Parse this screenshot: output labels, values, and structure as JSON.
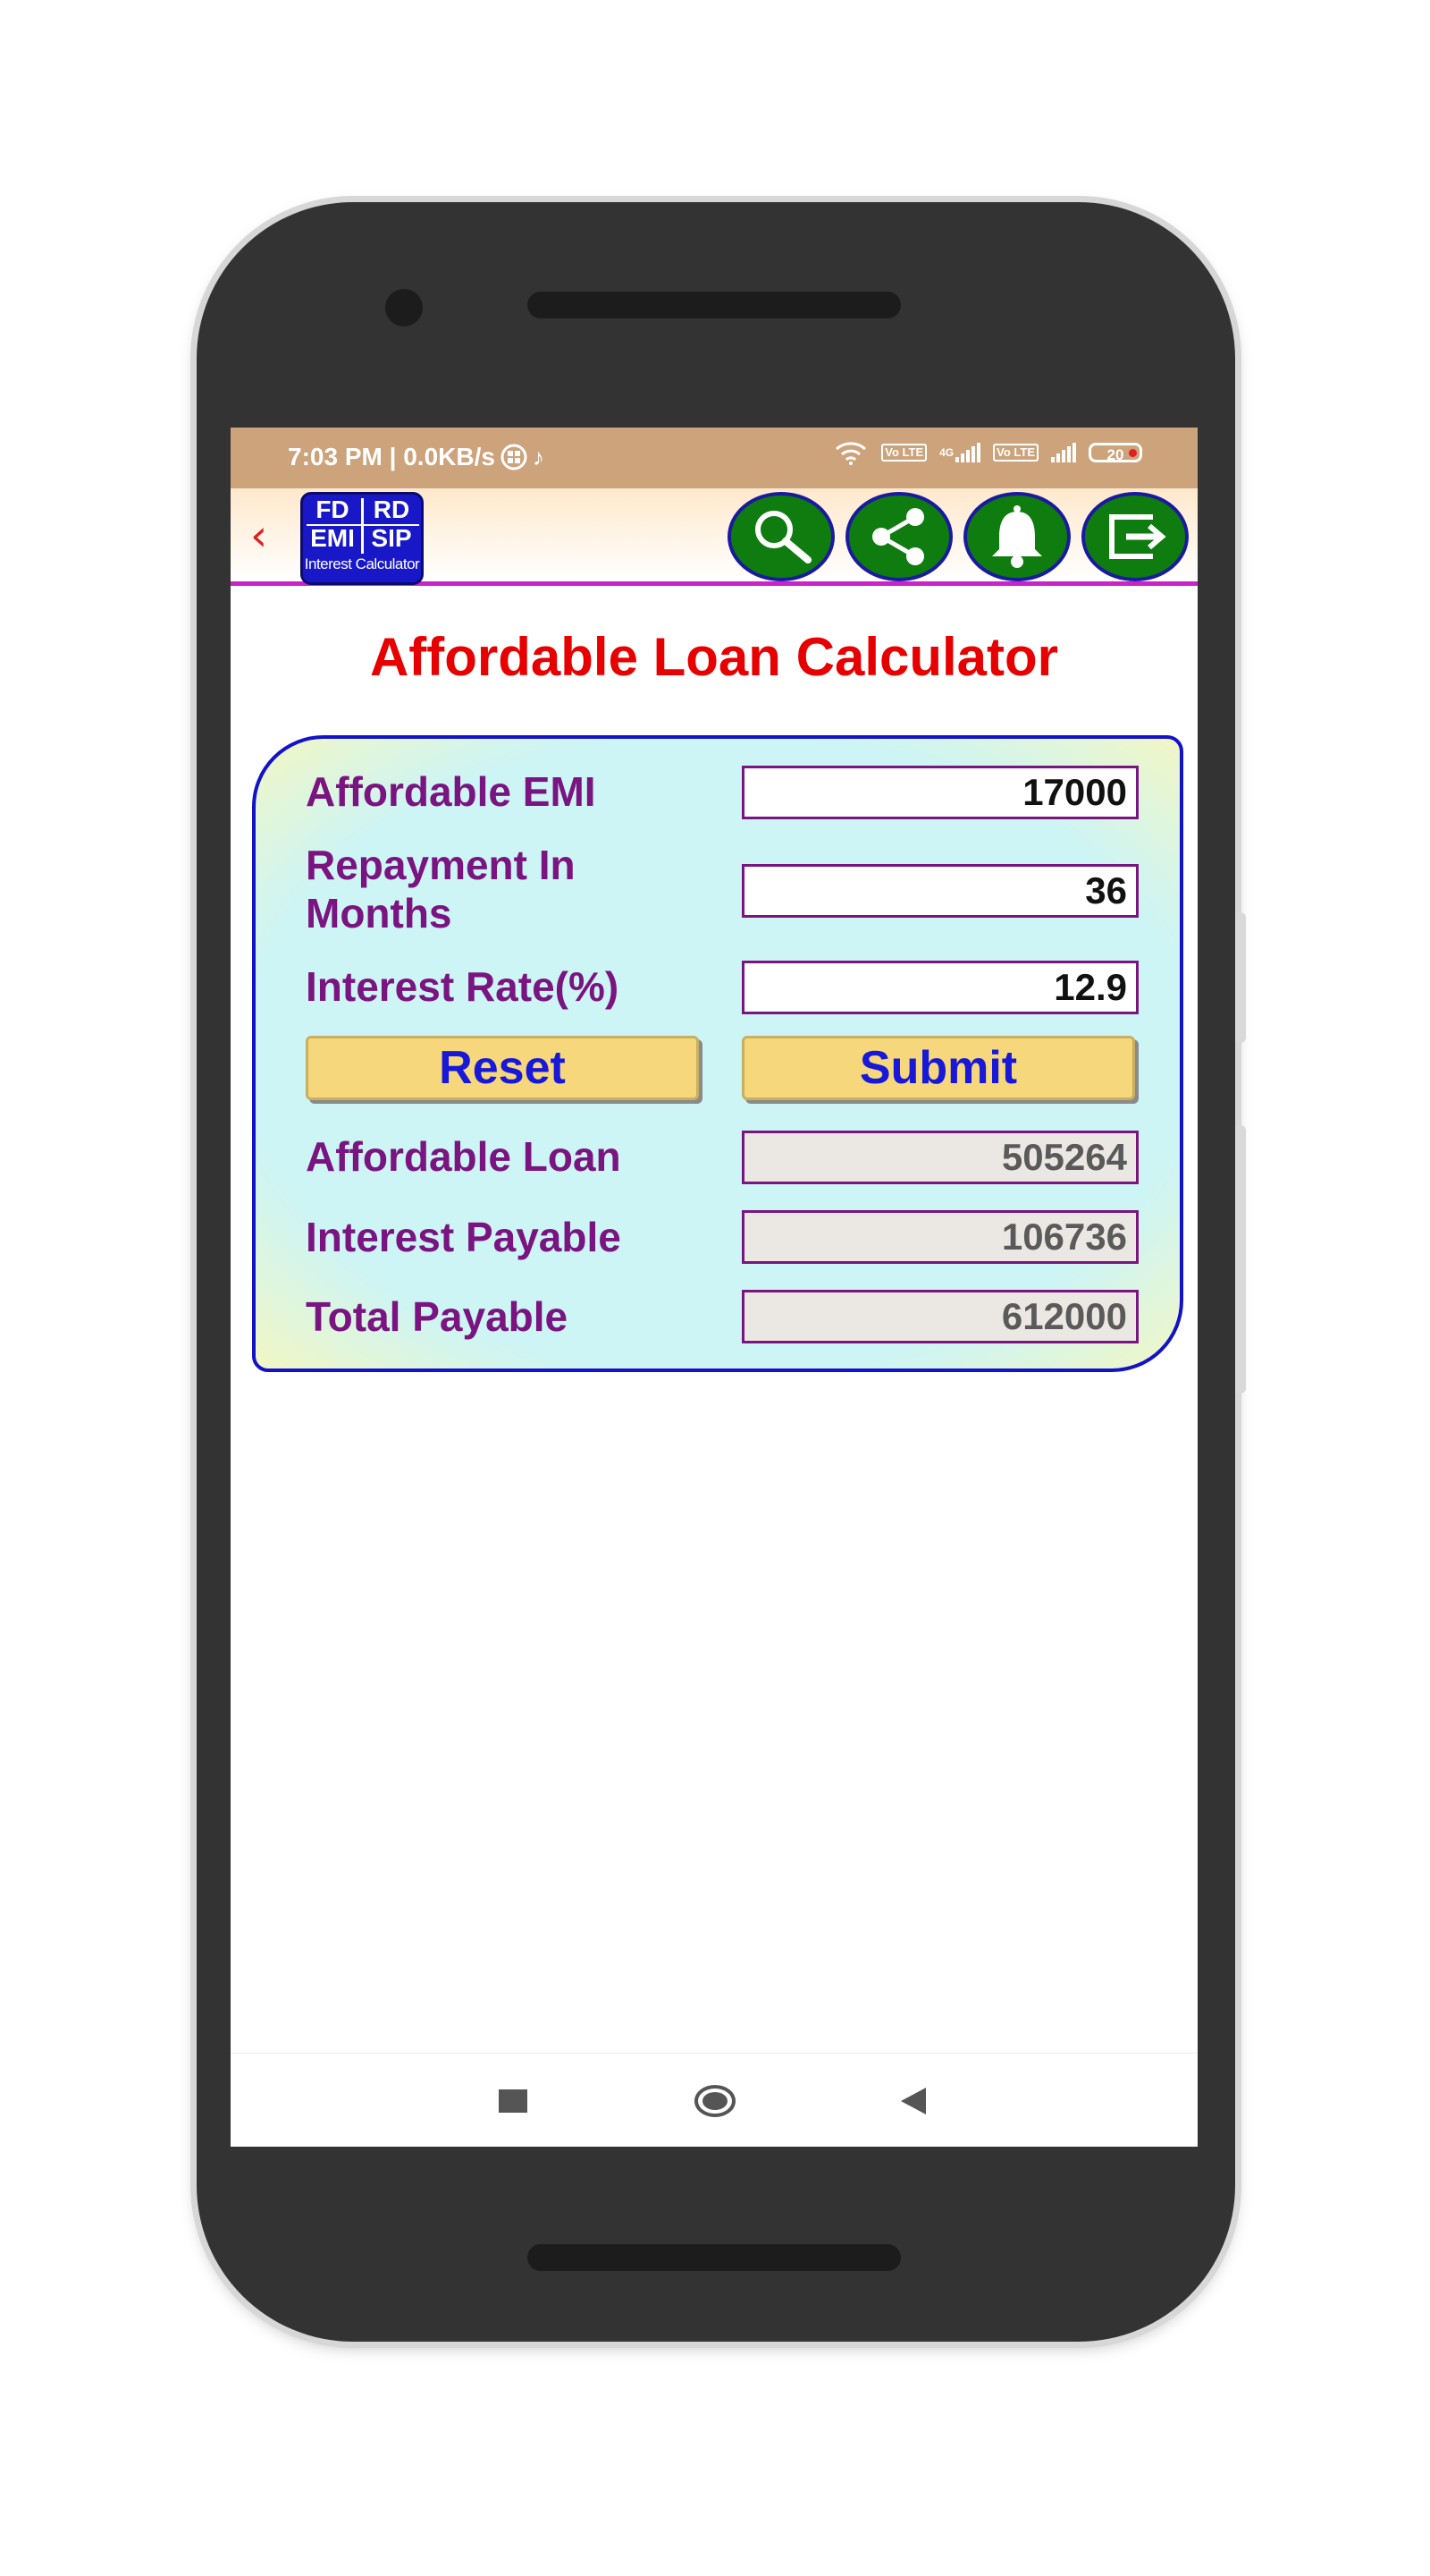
{
  "status_bar": {
    "time_network": "7:03 PM | 0.0KB/s",
    "icons": [
      "grid-icon",
      "tiktok-icon",
      "wifi-icon",
      "volte-icon",
      "signal-4g-icon",
      "volte-icon-2",
      "signal-icon"
    ],
    "sim1_badge": "Vo LTE",
    "net_badge": "4G",
    "sim2_badge": "Vo LTE",
    "battery": "20"
  },
  "app_bar": {
    "logo": {
      "tl": "FD",
      "tr": "RD",
      "bl": "EMI",
      "br": "SIP",
      "caption": "Interest Calculator"
    },
    "actions": [
      "search-icon",
      "share-icon",
      "bell-icon",
      "exit-icon"
    ],
    "accent": "#cc22cc"
  },
  "page": {
    "title": "Affordable Loan Calculator",
    "title_color": "#e60000"
  },
  "form": {
    "emi_label": "Affordable EMI",
    "emi_value": "17000",
    "months_label_line1": "Repayment In",
    "months_label_line2": "Months",
    "months_value": "36",
    "rate_label": "Interest Rate(%)",
    "rate_value": "12.9",
    "reset_label": "Reset",
    "submit_label": "Submit",
    "loan_label": "Affordable Loan",
    "loan_value": "505264",
    "interest_label": "Interest Payable",
    "interest_value": "106736",
    "total_label": "Total Payable",
    "total_value": "612000",
    "label_color": "#7a1480",
    "button_text_color": "#1818d8"
  },
  "nav_bar": {
    "items": [
      "recents-square-icon",
      "home-circle-icon",
      "back-triangle-icon"
    ]
  }
}
